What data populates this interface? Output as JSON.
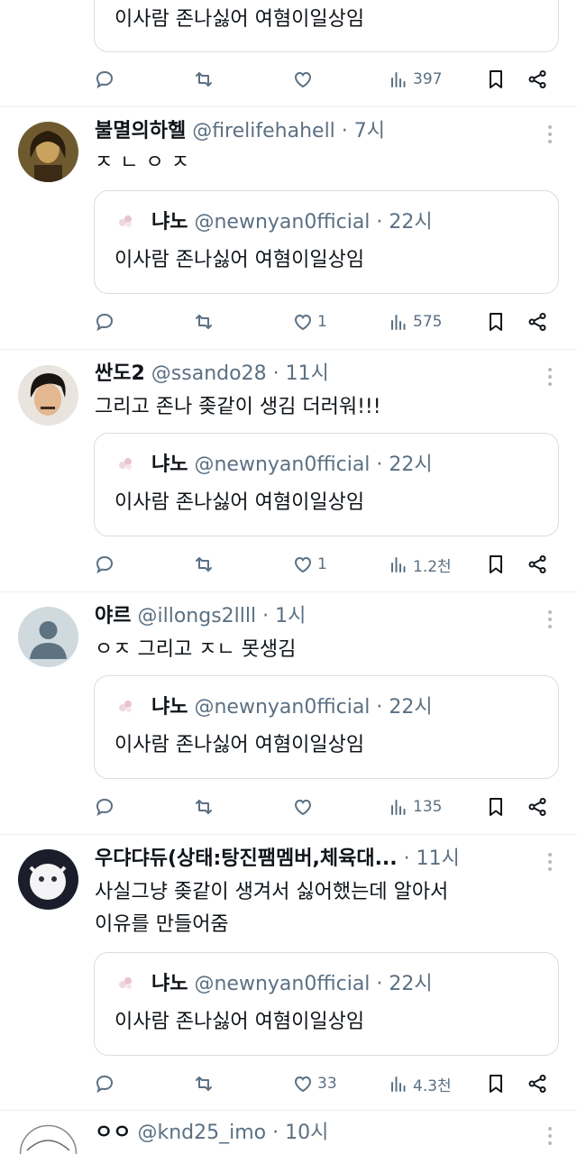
{
  "quoted": {
    "name": "냐노",
    "handle": "@newnyan0fficial",
    "sep": "·",
    "time": "22시",
    "text": "이사람 존나싫어 여혐이일상임"
  },
  "tweets": [
    {
      "quote_text": "이사람 존나싫어 여혐이일상임",
      "stats": {
        "reply": "",
        "retweet": "",
        "like": "",
        "views": "397"
      }
    },
    {
      "name": "불멸의하헬",
      "handle": "@firelifehahell",
      "sep": "·",
      "time": "7시",
      "text": "ㅈㄴㅇㅈ",
      "stats": {
        "reply": "",
        "retweet": "",
        "like": "1",
        "views": "575"
      }
    },
    {
      "name": "싼도2",
      "handle": "@ssando28",
      "sep": "·",
      "time": "11시",
      "text": "그리고 존나 좆같이 생김 더러워!!!",
      "stats": {
        "reply": "",
        "retweet": "",
        "like": "1",
        "views": "1.2천"
      }
    },
    {
      "name": "야르",
      "handle": "@illongs2llll",
      "sep": "·",
      "time": "1시",
      "text": "ㅇㅈ 그리고 ㅈㄴ 못생김",
      "stats": {
        "reply": "",
        "retweet": "",
        "like": "",
        "views": "135"
      }
    },
    {
      "name": "우댜댜듀(상태:탕진팸멤버,체육대...",
      "handle": "",
      "sep": "·",
      "time": "11시",
      "text_line1": "사실그냥 좆같이 생겨서 싫어했는데 알아서",
      "text_line2": "이유를 만들어줌",
      "stats": {
        "reply": "",
        "retweet": "",
        "like": "33",
        "views": "4.3천"
      }
    },
    {
      "name": "ㅇㅇ",
      "handle": "@knd25_imo",
      "sep": "·",
      "time": "10시"
    }
  ],
  "colors": {
    "text": "#0f1419",
    "secondary": "#5b7083",
    "border": "#eceef0",
    "card_border": "#d8dde2"
  }
}
